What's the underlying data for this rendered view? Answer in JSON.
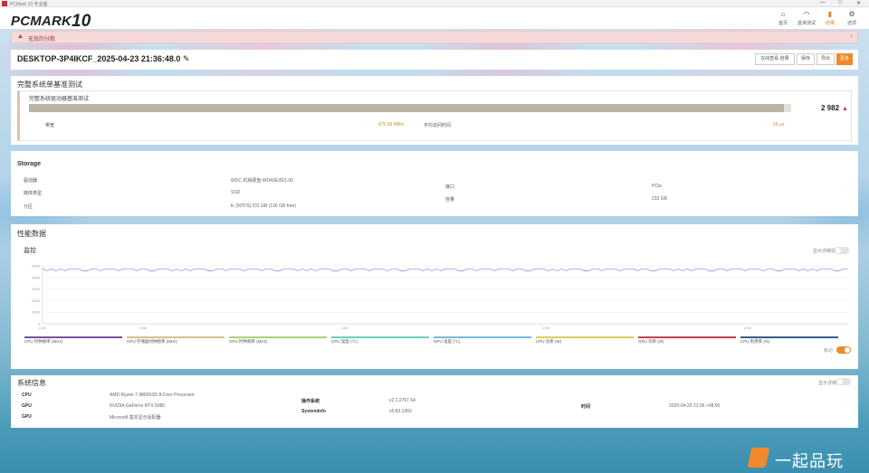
{
  "window": {
    "title": "PCMark 10 专业版",
    "controls": [
      "—",
      "□",
      "✕"
    ]
  },
  "header": {
    "logo": "PCMARK",
    "logo_suffix": "10",
    "nav": [
      {
        "label": "首页",
        "icon": "home-icon",
        "glyph": "⌂"
      },
      {
        "label": "基准测试",
        "icon": "gauge-icon",
        "glyph": "◠"
      },
      {
        "label": "结果",
        "icon": "bar-chart-icon",
        "glyph": "▮"
      },
      {
        "label": "选项",
        "icon": "gear-icon",
        "glyph": "⚙"
      }
    ]
  },
  "warning": {
    "text": "无效的分数",
    "expand": "↑"
  },
  "result": {
    "title": "DESKTOP-3P4IKCF_2025-04-23 21:36:48.0",
    "buttons": {
      "compare": "在线查看 结果",
      "save": "保存",
      "export": "导出",
      "more": "更多"
    }
  },
  "benchmark": {
    "section_title": "完整系统单基准测试",
    "subtitle": "完整系统驱动器基准测试",
    "score": "2 982",
    "progress": 0.99,
    "bandwidth_label": "带宽",
    "bandwidth_value": "475.99 MB/s",
    "latency_label": "平均访问时间",
    "latency_value": "56 μs"
  },
  "storage": {
    "title": "Storage",
    "rows": [
      {
        "label": "驱动器",
        "value": "WDC 机械硬盘 WD40EZRZ-00"
      },
      {
        "label": "媒体类型",
        "value": "SSD"
      },
      {
        "label": "分区",
        "value": "E: [NTFS] 231 GB (126 GB free)"
      }
    ],
    "right_rows": [
      {
        "label": "接口",
        "value": "PCIe"
      },
      {
        "label": "容量",
        "value": "233 GB"
      }
    ]
  },
  "performance": {
    "title": "性能数据",
    "monitor_title": "监控",
    "toggle_label": "显示详细信息",
    "smooth_label": "标记",
    "chart_data": {
      "type": "line",
      "y_ticks": [
        "5000",
        "4000",
        "3000",
        "2000",
        "1000",
        "0"
      ],
      "x_ticks": [
        "0:00",
        "0:30",
        "1:00",
        "1:30",
        "2:00",
        "2:30",
        "3:00",
        "3:30",
        "4:00"
      ],
      "ylim": [
        0,
        5000
      ],
      "series": [
        {
          "name": "CPU 时钟频率 (MHz)",
          "color": "#7a4fa0"
        },
        {
          "name": "GPU 存储器时钟频率 (MHz)",
          "color": "#d4c08a"
        },
        {
          "name": "GPU 时钟频率 (MHz)",
          "color": "#a8d47a"
        },
        {
          "name": "CPU 温度 (°C)",
          "color": "#6ad0c0"
        },
        {
          "name": "GPU 温度 (°C)",
          "color": "#79b8d8"
        },
        {
          "name": "CPU 功率 (W)",
          "color": "#d8cf5a"
        },
        {
          "name": "GPU 功率 (W)",
          "color": "#c8414f"
        },
        {
          "name": "CPU 利用率 (%)",
          "color": "#2f5f8a"
        }
      ]
    }
  },
  "sysinfo": {
    "title": "系统信息",
    "toggle_label": "显示详细信息",
    "rows": [
      {
        "label": "CPU",
        "value": "AMD Ryzen 7 9800X3D 8-Core Processor"
      },
      {
        "label": "GPU",
        "value": "NVIDIA GeForce RTX 5080"
      },
      {
        "label": "GPU",
        "value": "Microsoft 基本显示适配器"
      }
    ],
    "mid_rows": [
      {
        "label": "操作系统",
        "value": "v2.1.2767 64"
      },
      {
        "label": "SystemInfo",
        "value": "v5.83.1360"
      }
    ],
    "right_rows": [
      {
        "label": "时间",
        "value": "2025-04-23 21:36 +08:00"
      }
    ]
  },
  "watermark": {
    "text": "一起品玩"
  }
}
